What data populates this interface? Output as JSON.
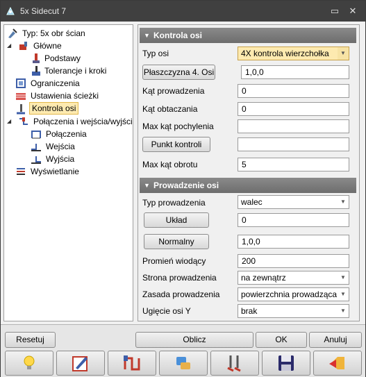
{
  "window": {
    "title": "5x Sidecut 7"
  },
  "tree": {
    "items": [
      {
        "label": "Typ: 5x obr ścian"
      },
      {
        "label": "Główne"
      },
      {
        "label": "Podstawy"
      },
      {
        "label": "Tolerancje i kroki"
      },
      {
        "label": "Ograniczenia"
      },
      {
        "label": "Ustawienia ścieżki"
      },
      {
        "label": "Kontrola osi"
      },
      {
        "label": "Połączenia i wejścia/wyjścia"
      },
      {
        "label": "Połączenia"
      },
      {
        "label": "Wejścia"
      },
      {
        "label": "Wyjścia"
      },
      {
        "label": "Wyświetlanie"
      }
    ]
  },
  "axis_control": {
    "header": "Kontrola osi",
    "axis_type_label": "Typ osi",
    "axis_type_value": "4X kontrola wierzchołka",
    "plane_button": "Płaszczyzna 4. Osi",
    "plane_value": "1,0,0",
    "lead_angle_label": "Kąt prowadzenia",
    "lead_angle_value": "0",
    "tilt_angle_label": "Kąt obtaczania",
    "tilt_angle_value": "0",
    "max_tilt_label": "Max kąt pochylenia",
    "max_tilt_value": "",
    "control_point_button": "Punkt kontroli",
    "control_point_value": "",
    "max_rotation_label": "Max kąt obrotu",
    "max_rotation_value": "5"
  },
  "guidance": {
    "header": "Prowadzenie osi",
    "type_label": "Typ prowadzenia",
    "type_value": "walec",
    "layout_button": "Układ",
    "layout_value": "0",
    "normal_button": "Normalny",
    "normal_value": "1,0,0",
    "radius_label": "Promień wiodący",
    "radius_value": "200",
    "side_label": "Strona prowadzenia",
    "side_value": "na zewnątrz",
    "rule_label": "Zasada prowadzenia",
    "rule_value": "powierzchnia prowadząca",
    "deflection_label": "Ugięcie osi Y",
    "deflection_value": "brak"
  },
  "buttons": {
    "reset": "Resetuj",
    "compute": "Oblicz",
    "ok": "OK",
    "cancel": "Anuluj"
  },
  "icon_buttons": [
    "lightbulb-icon",
    "edit-icon",
    "toolpath-icon",
    "tool-info-icon",
    "compare-icon",
    "save-icon",
    "exit-icon"
  ],
  "colors": {
    "title_bar": "#404040",
    "section_header": "#7a7a7a",
    "selection": "#fdeab0"
  }
}
